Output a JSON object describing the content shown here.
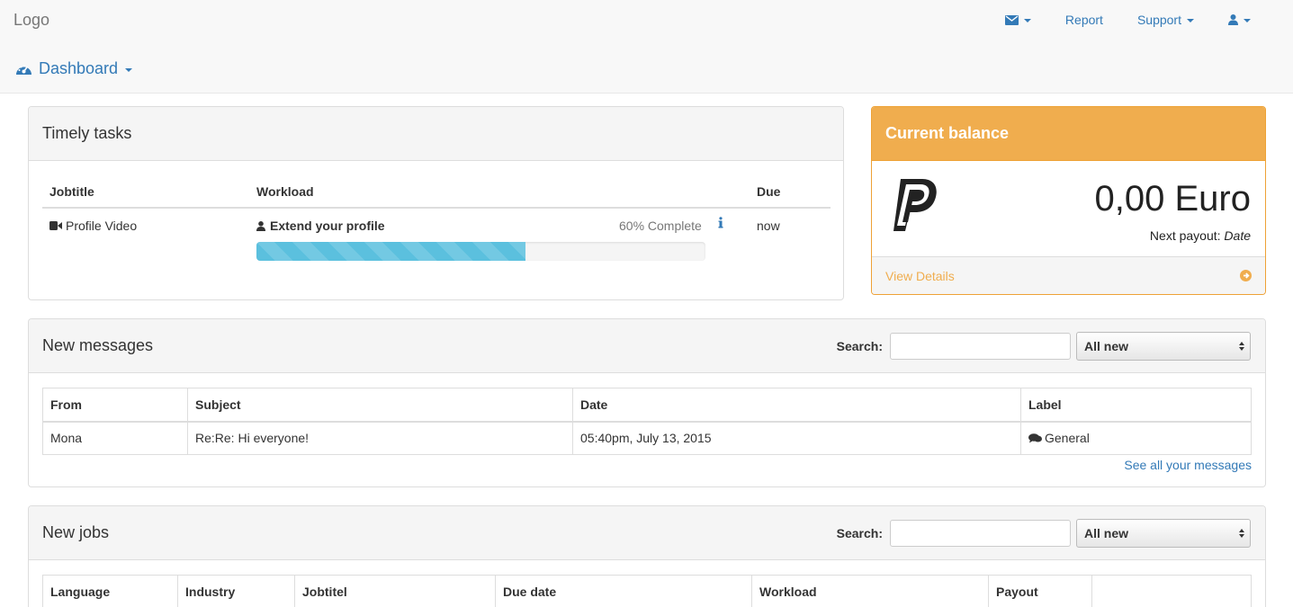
{
  "navbar": {
    "logo": "Logo",
    "report": "Report",
    "support": "Support",
    "dashboard": "Dashboard"
  },
  "tasks": {
    "title": "Timely tasks",
    "headers": {
      "jobtitle": "Jobtitle",
      "workload": "Workload",
      "due": "Due"
    },
    "row": {
      "jobtitle": "Profile Video",
      "workload": "Extend your profile",
      "progress_text": "60% Complete",
      "progress_value": 60,
      "due": "now"
    }
  },
  "balance": {
    "title": "Current balance",
    "amount": "0,00 Euro",
    "payout_label": "Next payout:",
    "payout_value": "Date",
    "view_details": "View Details",
    "accent_color": "#f0ad4e"
  },
  "messages": {
    "title": "New messages",
    "search_label": "Search:",
    "filter": "All new",
    "headers": [
      "From",
      "Subject",
      "Date",
      "Label"
    ],
    "rows": [
      {
        "from": "Mona",
        "subject": "Re:Re: Hi everyone!",
        "date": "05:40pm, July 13, 2015",
        "label": "General"
      }
    ],
    "see_all": "See all your messages"
  },
  "jobs": {
    "title": "New jobs",
    "search_label": "Search:",
    "filter": "All new",
    "headers": [
      "Language",
      "Industry",
      "Jobtitel",
      "Due date",
      "Workload",
      "Payout",
      ""
    ]
  },
  "colors": {
    "link": "#337ab7",
    "warning": "#f0ad4e",
    "info": "#5bc0de"
  }
}
